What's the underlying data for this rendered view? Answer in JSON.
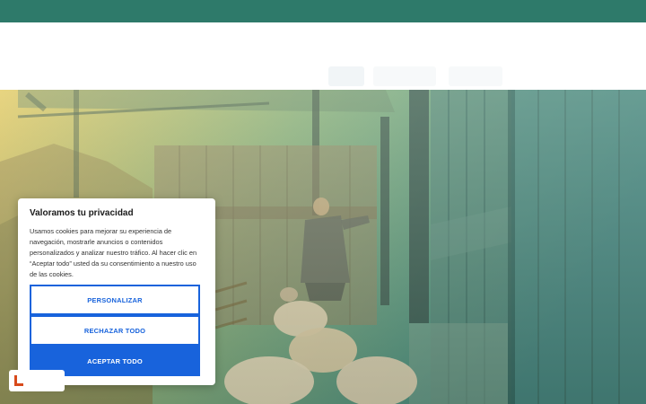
{
  "cookie_banner": {
    "title": "Valoramos tu privacidad",
    "description": "Usamos cookies para mejorar su experiencia de navegación, mostrarle anuncios o contenidos personalizados y analizar nuestro tráfico. Al hacer clic en “Aceptar todo” usted da su consentimiento a nuestro uso de las cookies.",
    "customize_label": "PERSONALIZAR",
    "reject_label": "RECHAZAR TODO",
    "accept_label": "ACEPTAR TODO"
  },
  "colors": {
    "top_bar": "#2e7a6a",
    "primary_button": "#1863dc",
    "revisit_logo": "#d84a1b"
  },
  "icons": {
    "revisit_consent": "logo-mark-icon"
  }
}
